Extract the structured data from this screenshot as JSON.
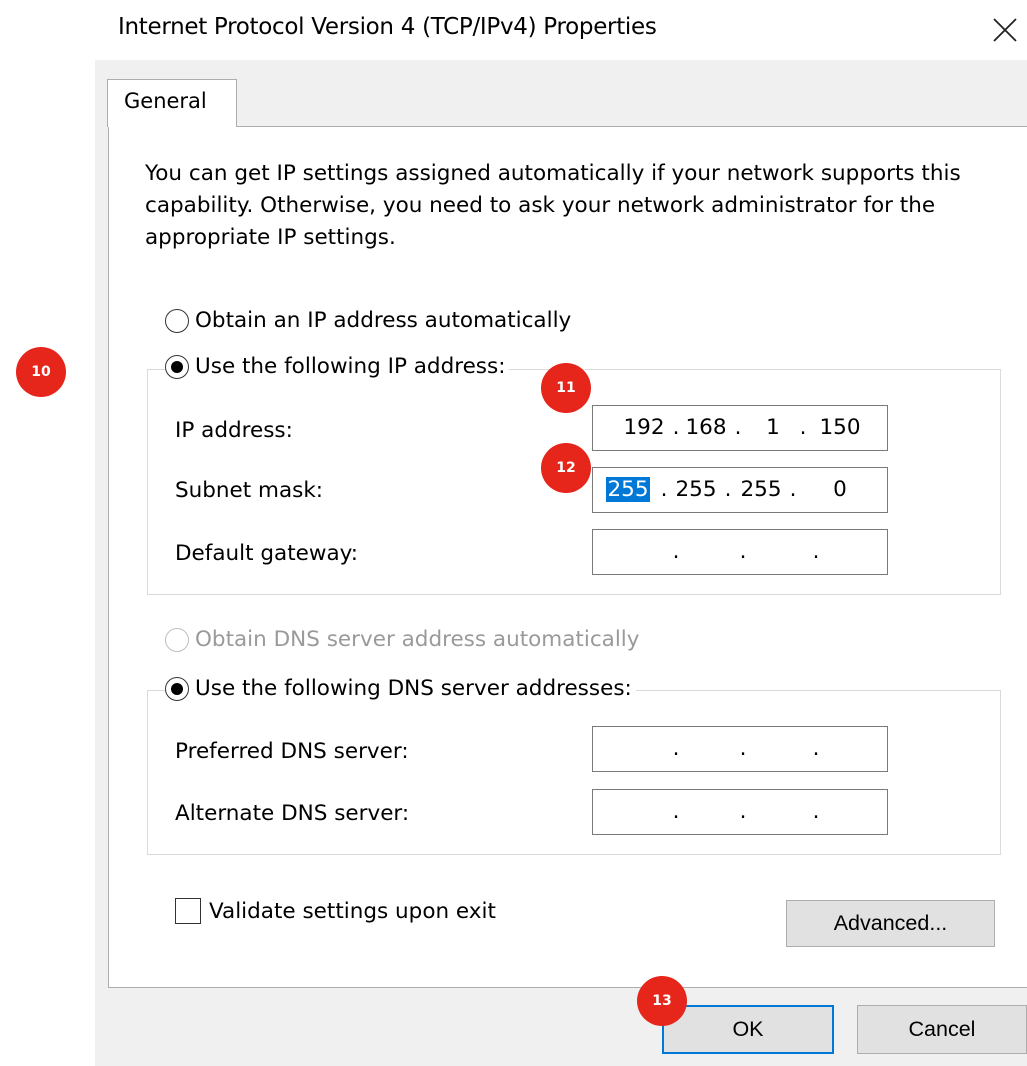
{
  "window": {
    "title": "Internet Protocol Version 4 (TCP/IPv4) Properties",
    "close_glyph": "✕"
  },
  "tabs": [
    {
      "label": "General",
      "active": true
    }
  ],
  "description": "You can get IP settings assigned automatically if your network supports this capability. Otherwise, you need to ask your network administrator for the appropriate IP settings.",
  "ip_section": {
    "auto_label": "Obtain an IP address automatically",
    "auto_selected": false,
    "manual_label": "Use the following IP address:",
    "manual_selected": true,
    "fields": {
      "ip_address": {
        "label": "IP address:",
        "octets": [
          "192",
          "168",
          "1",
          "150"
        ]
      },
      "subnet_mask": {
        "label": "Subnet mask:",
        "octets": [
          "255",
          "255",
          "255",
          "0"
        ],
        "selected_octet_index": 0
      },
      "default_gateway": {
        "label": "Default gateway:",
        "octets": [
          "",
          "",
          "",
          ""
        ]
      }
    }
  },
  "dns_section": {
    "auto_label": "Obtain DNS server address automatically",
    "auto_selected": false,
    "auto_enabled": false,
    "manual_label": "Use the following DNS server addresses:",
    "manual_selected": true,
    "fields": {
      "preferred": {
        "label": "Preferred DNS server:",
        "octets": [
          "",
          "",
          "",
          ""
        ]
      },
      "alternate": {
        "label": "Alternate DNS server:",
        "octets": [
          "",
          "",
          "",
          ""
        ]
      }
    }
  },
  "validate": {
    "label": "Validate settings upon exit",
    "checked": false
  },
  "buttons": {
    "advanced": "Advanced...",
    "ok": "OK",
    "cancel": "Cancel"
  },
  "markers": [
    "10",
    "11",
    "12",
    "13"
  ],
  "colors": {
    "marker": "#e6261b",
    "selection": "#0078d7",
    "dialog_bg": "#f0f0f0"
  }
}
